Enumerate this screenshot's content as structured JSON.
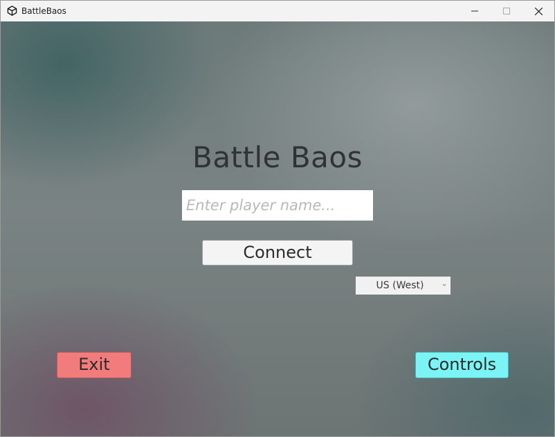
{
  "window": {
    "title": "BattleBaos",
    "app_icon": "unity-logo-icon",
    "controls": {
      "minimize_icon": "minimize-icon",
      "maximize_icon": "maximize-icon",
      "close_icon": "close-icon"
    }
  },
  "menu": {
    "title": "Battle Baos",
    "player_name": {
      "value": "",
      "placeholder": "Enter player name..."
    },
    "connect_label": "Connect",
    "region": {
      "selected": "US (West)",
      "arrow_icon": "dropdown-arrow-icon"
    },
    "exit_label": "Exit",
    "controls_label": "Controls"
  },
  "colors": {
    "exit_button": "#f27b7b",
    "controls_button": "#7af4f4",
    "title_text": "#2f3336"
  }
}
